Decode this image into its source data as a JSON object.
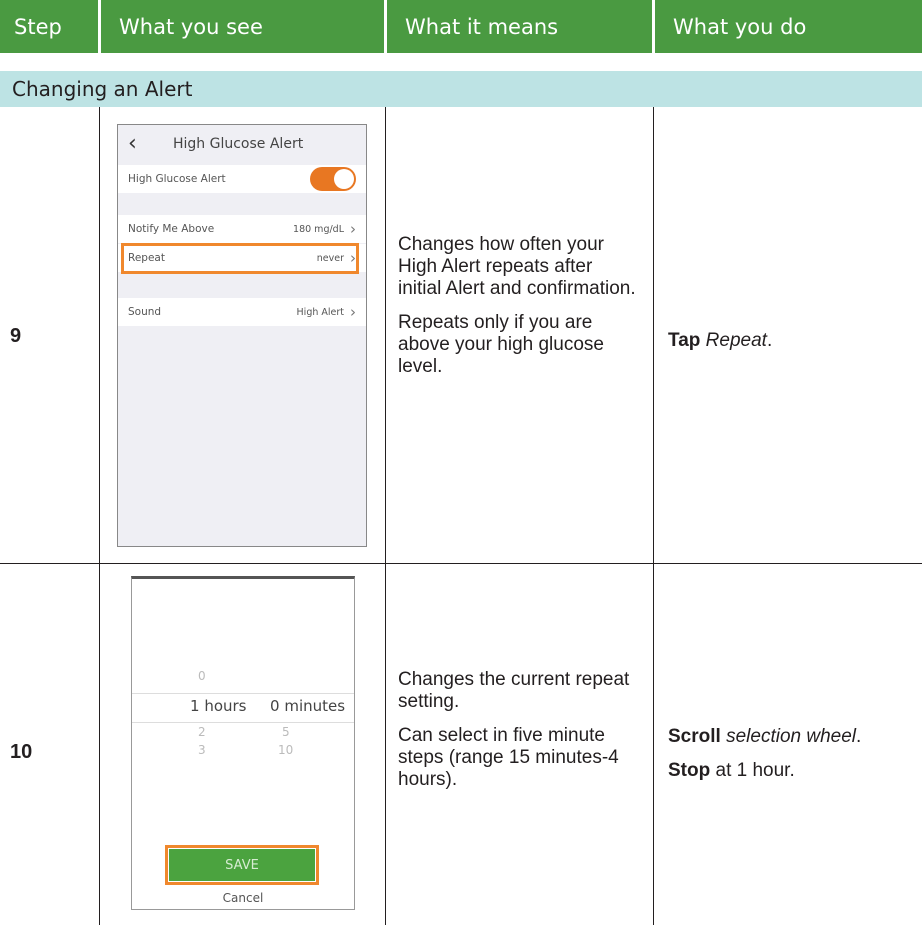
{
  "headers": [
    "Step",
    "What you see",
    "What it means",
    "What you do"
  ],
  "section_title": "Changing an Alert",
  "rows": [
    {
      "step": "9",
      "screen": {
        "title": "High Glucose Alert",
        "toggle_label": "High Glucose Alert",
        "notify_label": "Notify Me Above",
        "notify_value": "180 mg/dL",
        "repeat_label": "Repeat",
        "repeat_value": "never",
        "sound_label": "Sound",
        "sound_value": "High Alert"
      },
      "meaning": [
        "Changes how often your High Alert repeats after initial Alert and confirmation.",
        "Repeats only if you are above your high glucose level."
      ],
      "todo": {
        "action": "Tap",
        "target": "Repeat",
        "end": "."
      }
    },
    {
      "step": "10",
      "screen": {
        "above_hours": "0",
        "selected_hours": "1",
        "hours_unit": "hours",
        "selected_minutes": "0",
        "minutes_unit": "minutes",
        "below_hours_1": "2",
        "below_minutes_1": "5",
        "below_hours_2": "3",
        "below_minutes_2": "10",
        "save_label": "SAVE",
        "cancel_label": "Cancel"
      },
      "meaning": [
        "Changes the current repeat setting.",
        "Can select in five minute steps (range 15 minutes-4 hours)."
      ],
      "todo": [
        {
          "action": "Scroll",
          "target": "selection wheel",
          "end": "."
        },
        {
          "action": "Stop",
          "rest": "at 1 hour."
        }
      ]
    }
  ]
}
